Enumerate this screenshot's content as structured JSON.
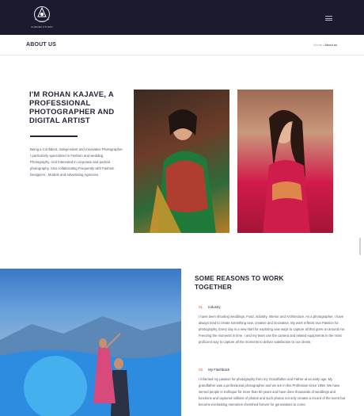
{
  "header": {
    "logo_text": "AURORA STUDIO",
    "menu_icon": "hamburger-menu-icon"
  },
  "titlebar": {
    "title": "ABOUT US",
    "breadcrumb": {
      "home": "Home",
      "separator": " / ",
      "current": "About us"
    }
  },
  "intro": {
    "heading": "I'M ROHAN KAJAVE, A PROFESSIONAL PHOTOGRAPHER AND DIGITAL ARTIST",
    "body": "Being a Confident, Independent and Innovative Photographer. I particularly specialized in Fashion and wedding Photography. And Interested in corporate and portrait photography. Also collaborating Frequently with Fashion Designers , Models and Advertising Agencies."
  },
  "reasons": {
    "heading": "SOME REASONS TO WORK TOGETHER",
    "items": [
      {
        "num": "01.",
        "title": "Industry",
        "body": "I have been shooting weddings, Food, industry, Interior and Architecture. As a photographer, I have always tried to create something new, creative and innovative. My work reflects true Passion for photography. Every day is a new start for exploring new ways to capture all that goes on around me. Freezing the moments in time. I and my team use the camera and related equipments in the most proficient way to capture all the moments to deliver satisfaction to our clients."
      },
      {
        "num": "02.",
        "title": "My Flashback",
        "body": "I inherited my passion for photography from my Grandfather and Father at an early age. My grandfather was a professional photographer and we are in this Profession since 1958. We have served people in Kolhapur for more than 60 years and have done thousands of weddings and functions and captured millions of photos and such photos not only creates a record of the event but become everlasting memories cherished forever for generations to come."
      }
    ]
  },
  "colors": {
    "header_bg": "#1c1a2e",
    "heading": "#252538",
    "accent": "#d9533c"
  }
}
